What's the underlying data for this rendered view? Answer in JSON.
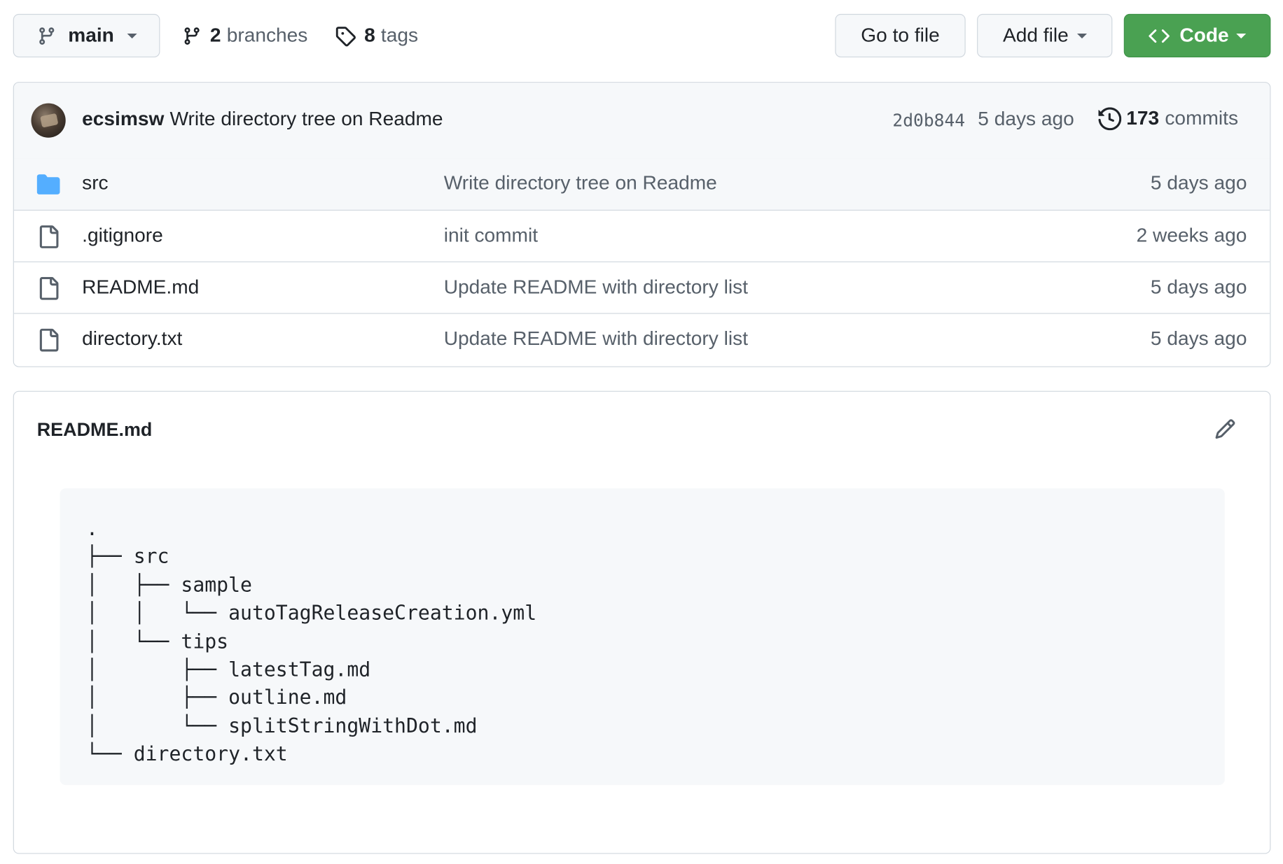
{
  "toolbar": {
    "branch": "main",
    "branches_count": "2",
    "branches_label": "branches",
    "tags_count": "8",
    "tags_label": "tags",
    "go_to_file": "Go to file",
    "add_file": "Add file",
    "code": "Code"
  },
  "latest_commit": {
    "author": "ecsimsw",
    "message": "Write directory tree on Readme",
    "sha": "2d0b844",
    "time": "5 days ago",
    "commits_count": "173",
    "commits_label": "commits"
  },
  "files": [
    {
      "name": "src",
      "type": "folder",
      "message": "Write directory tree on Readme",
      "age": "5 days ago"
    },
    {
      "name": ".gitignore",
      "type": "file",
      "message": "init commit",
      "age": "2 weeks ago"
    },
    {
      "name": "README.md",
      "type": "file",
      "message": "Update README with directory list",
      "age": "5 days ago"
    },
    {
      "name": "directory.txt",
      "type": "file",
      "message": "Update README with directory list",
      "age": "5 days ago"
    }
  ],
  "readme": {
    "title": "README.md",
    "tree": ".\n├── src\n│   ├── sample\n│   │   └── autoTagReleaseCreation.yml\n│   └── tips\n│       ├── latestTag.md\n│       ├── outline.md\n│       └── splitStringWithDot.md\n└── directory.txt"
  },
  "colors": {
    "code_button": "#4aa152",
    "folder_icon": "#54aeff",
    "border": "#d0d7de",
    "muted_text": "#57606a"
  },
  "icons": {
    "branch": "git-branch-icon",
    "tag": "tag-icon",
    "code": "code-icon",
    "history": "history-icon",
    "folder": "folder-icon",
    "file": "file-icon",
    "edit": "pencil-icon"
  }
}
